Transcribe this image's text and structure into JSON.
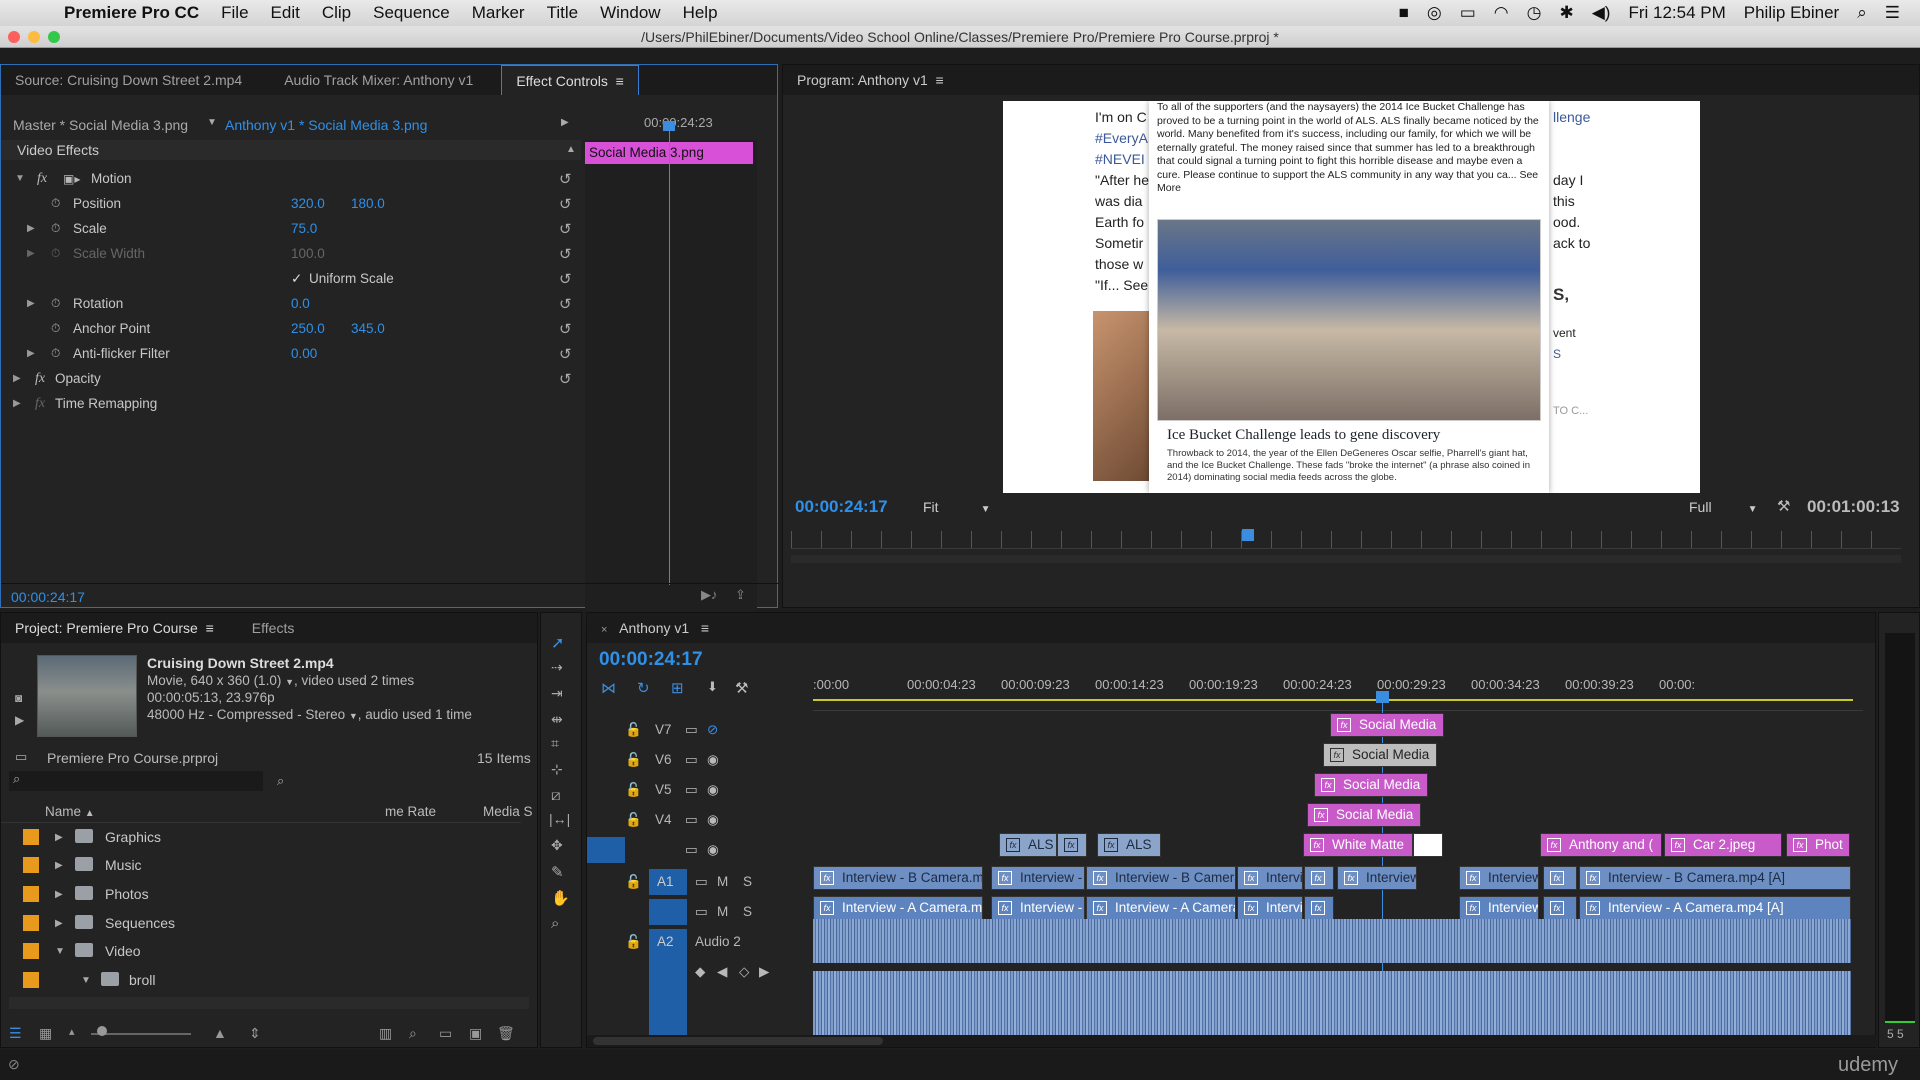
{
  "menubar": {
    "app": "Premiere Pro CC",
    "items": [
      "File",
      "Edit",
      "Clip",
      "Sequence",
      "Marker",
      "Title",
      "Window",
      "Help"
    ],
    "clock": "Fri 12:54 PM",
    "user": "Philip Ebiner"
  },
  "window_title": "/Users/PhilEbiner/Documents/Video School Online/Classes/Premiere Pro/Premiere Pro Course.prproj *",
  "source_panel": {
    "tabs": [
      "Source: Cruising Down Street 2.mp4",
      "Audio Track Mixer: Anthony v1",
      "Effect Controls"
    ],
    "master_label": "Master * Social Media 3.png",
    "sequence_label": "Anthony v1 * Social Media 3.png",
    "header_time": "00:00:24:23",
    "clip_label": "Social Media 3.png",
    "section": "Video Effects",
    "motion": "Motion",
    "rows": [
      {
        "name": "Position",
        "v1": "320.0",
        "v2": "180.0"
      },
      {
        "name": "Scale",
        "v1": "75.0"
      },
      {
        "name": "Scale Width",
        "v1": "100.0"
      },
      {
        "name": "Uniform Scale"
      },
      {
        "name": "Rotation",
        "v1": "0.0"
      },
      {
        "name": "Anchor Point",
        "v1": "250.0",
        "v2": "345.0"
      },
      {
        "name": "Anti-flicker Filter",
        "v1": "0.00"
      }
    ],
    "opacity": "Opacity",
    "time_remap": "Time Remapping",
    "timecode": "00:00:24:17"
  },
  "program": {
    "title": "Program: Anthony v1",
    "timecode": "00:00:24:17",
    "fit": "Fit",
    "full": "Full",
    "duration": "00:01:00:13",
    "post_text": "To all of the supporters (and the naysayers) the 2014 Ice Bucket Challenge has proved to be a turning point in the world of ALS. ALS finally became noticed by the world. Many benefited from it's success, including our family, for which we will be eternally grateful. The money raised since that summer has led to a breakthrough that could signal a turning point to fight this horrible disease and maybe even a cure. Please continue to support the ALS community in any way that you ca... See More",
    "headline": "Ice Bucket Challenge leads to gene discovery",
    "subtext": "Throwback to 2014, the year of the Ellen DeGeneres Oscar selfie, Pharrell's giant hat, and the Ice Bucket Challenge. These fads \"broke the internet\" (a phrase also coined in 2014) dominating social media feeds across the globe.",
    "left_frag": [
      "I'm on C",
      "#EveryA",
      "#NEVEI",
      "\"After he",
      "was dia",
      "Earth fo",
      "Sometir",
      "those w",
      "\"If... See"
    ],
    "right_frag": [
      "llenge",
      "day I",
      "this",
      "ood.",
      "ack to",
      "S,",
      "vent",
      "S",
      "TO C..."
    ]
  },
  "project": {
    "tabs": [
      "Project: Premiere Pro Course",
      "Effects"
    ],
    "clip_name": "Cruising Down Street 2.mp4",
    "clip_info1": "Movie, 640 x 360 (1.0)",
    "clip_info1b": ", video used 2 times",
    "clip_info2": "00:00:05:13, 23.976p",
    "clip_info3": "48000 Hz - Compressed - Stereo",
    "clip_info3b": ", audio used 1 time",
    "file": "Premiere Pro Course.prproj",
    "count": "15 Items",
    "col_name": "Name",
    "col_rate": "me Rate",
    "col_media": "Media S",
    "items": [
      "Graphics",
      "Music",
      "Photos",
      "Sequences",
      "Video",
      "broll"
    ]
  },
  "timeline": {
    "tab": "Anthony v1",
    "timecode": "00:00:24:17",
    "ruler": [
      ":00:00",
      "00:00:04:23",
      "00:00:09:23",
      "00:00:14:23",
      "00:00:19:23",
      "00:00:24:23",
      "00:00:29:23",
      "00:00:34:23",
      "00:00:39:23",
      "00:00:"
    ],
    "tracks": [
      "V7",
      "V6",
      "V5",
      "V4",
      "A1",
      "A2"
    ],
    "a2_name": "Audio 2",
    "m": "M",
    "s": "S",
    "clips": {
      "v7": "Social Media",
      "v6": "Social Media",
      "v5": "Social Media",
      "v4": "Social Media",
      "v3a": "ALS",
      "v3b": "ALS",
      "v3c": "White Matte",
      "v3d": "Anthony and (",
      "v3e": "Car 2.jpeg",
      "v3f": "Phot",
      "v2a": "Interview - B Camera.m",
      "v2b": "Interview -",
      "v2c": "Interview - B Camera",
      "v2d": "Intervi",
      "v2e": "Interview",
      "v2f": "Interview - B Camera.mp4 [A]",
      "v1a": "Interview - A Camera.m",
      "v1b": "Interview -",
      "v1c": "Interview - A Camera",
      "v1d": "Intervi",
      "v1e": "Interview",
      "v1f": "Interview - A Camera.mp4 [A]"
    }
  },
  "meter": "5 5",
  "watermark": "udemy"
}
